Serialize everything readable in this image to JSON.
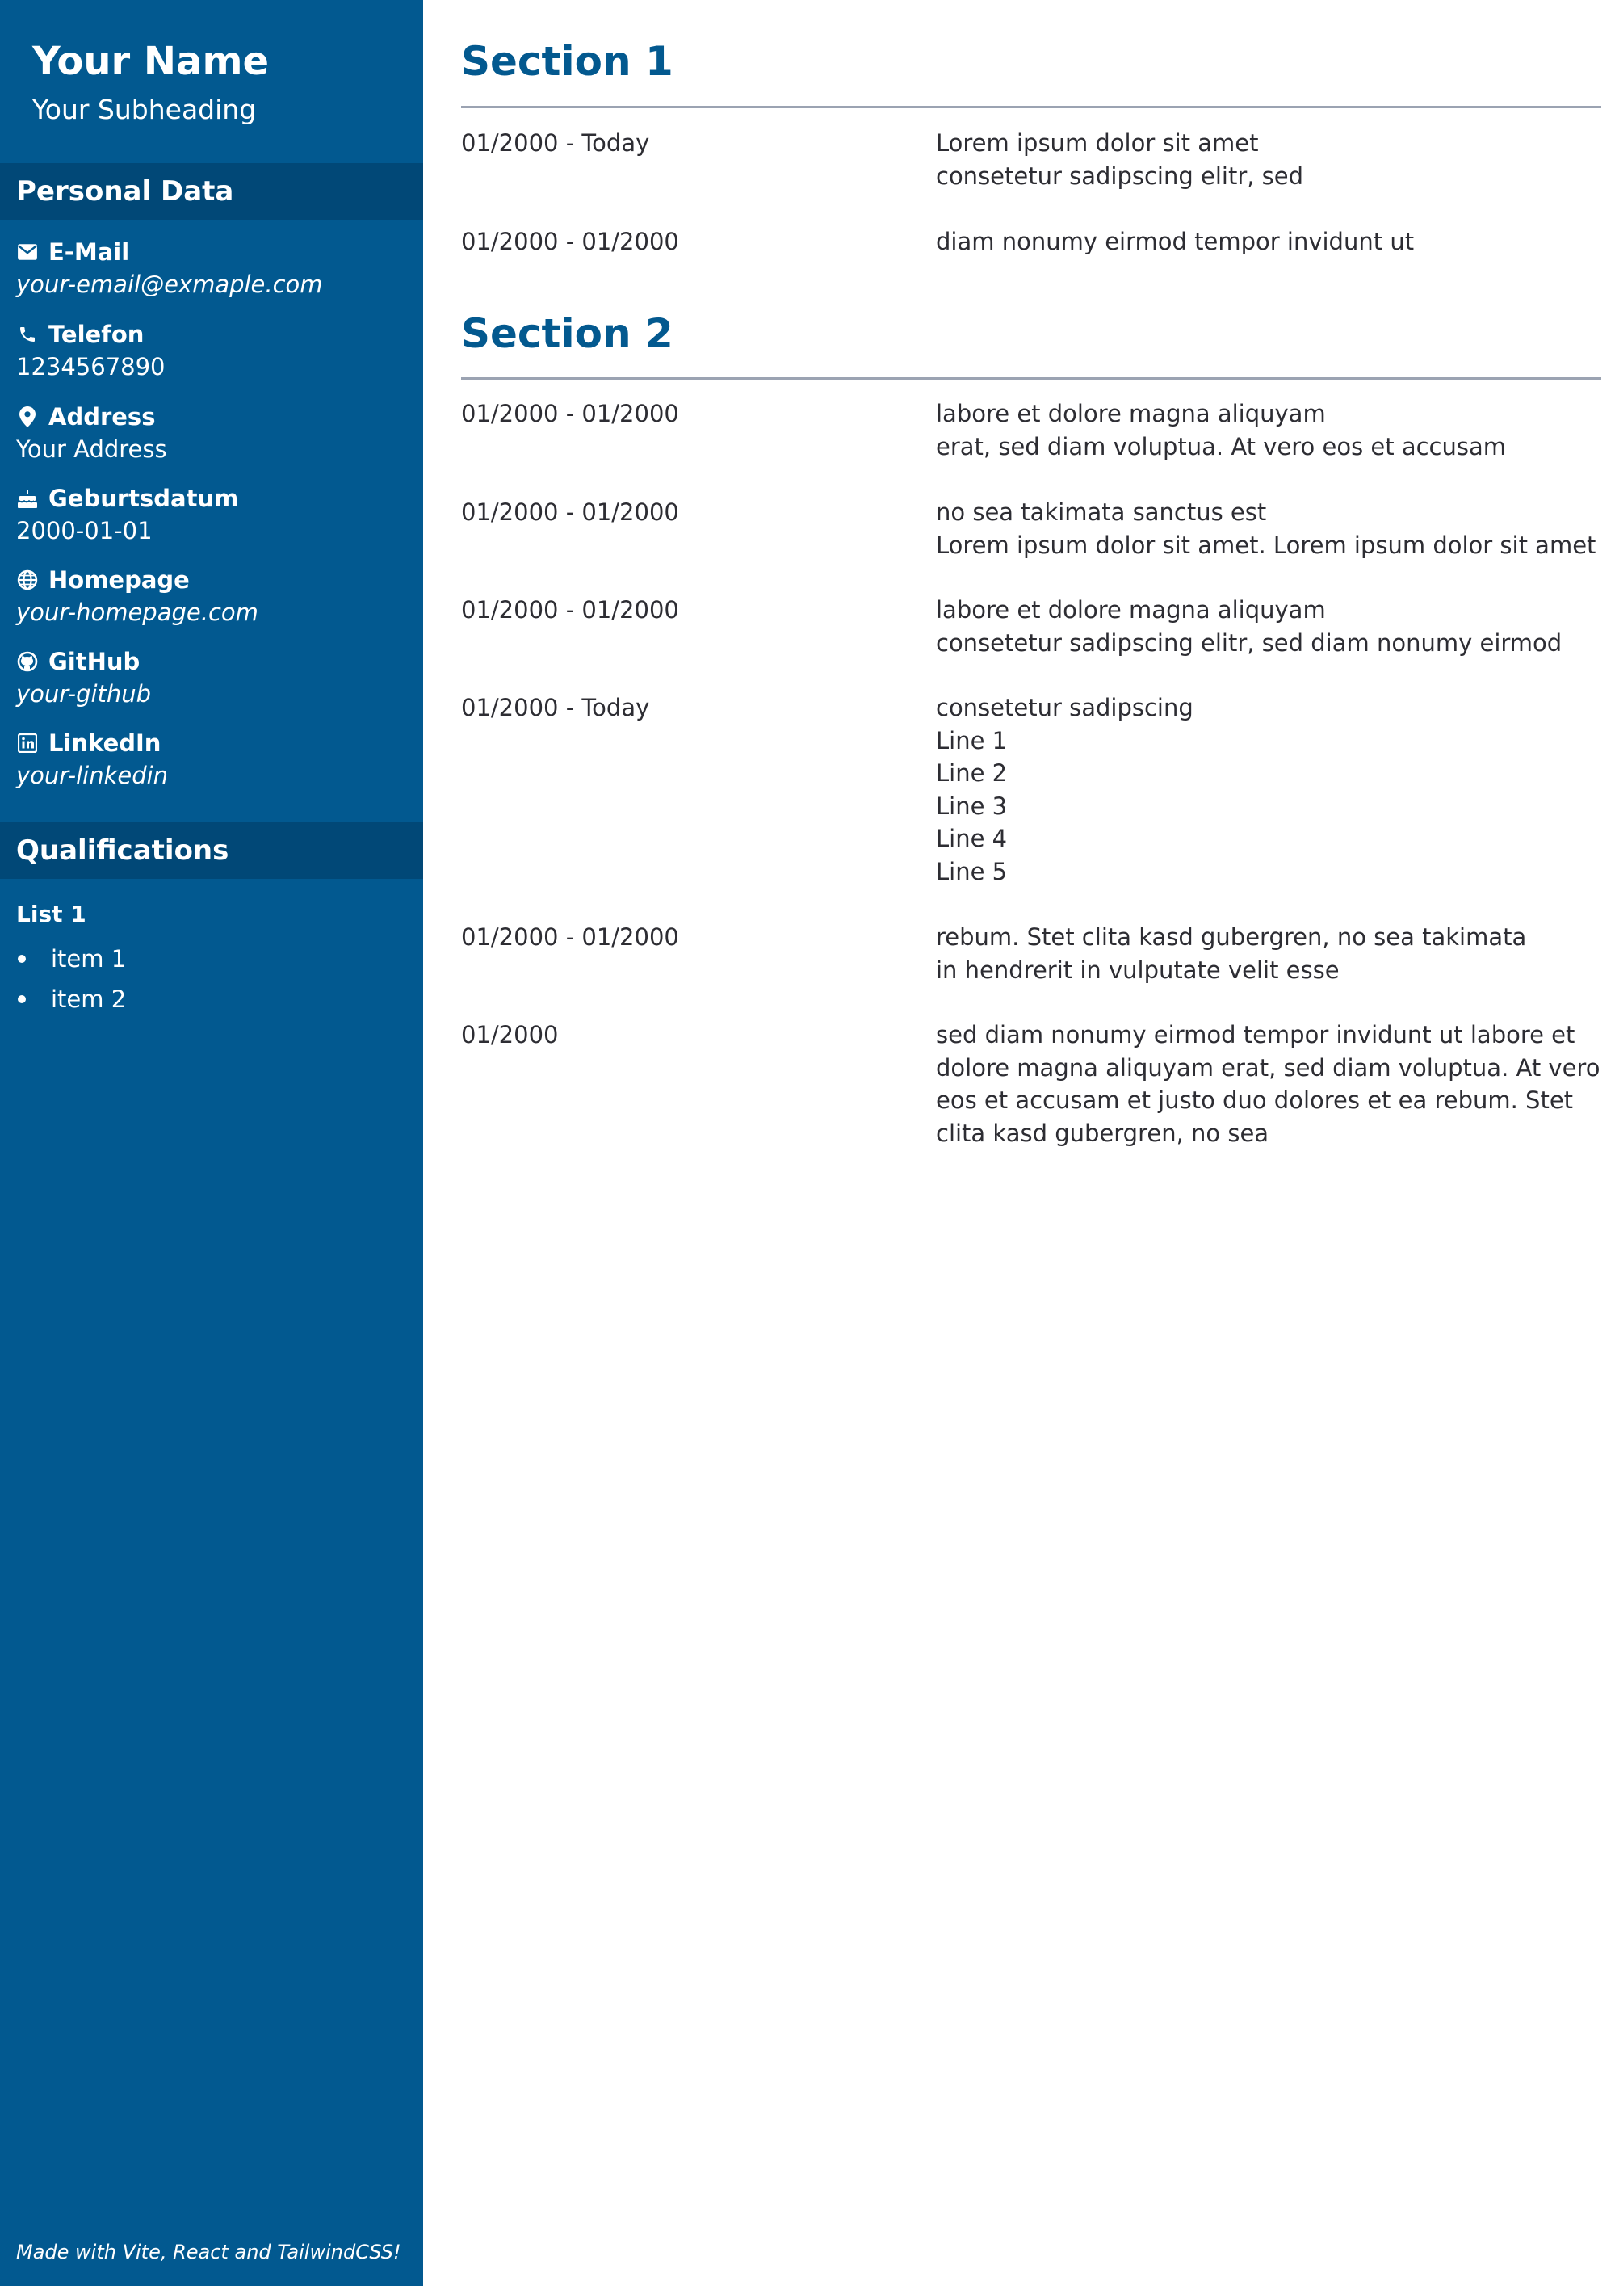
{
  "sidebar": {
    "name": "Your Name",
    "subheading": "Your Subheading",
    "personal_data_title": "Personal Data",
    "contacts": [
      {
        "icon": "mail-icon",
        "label": "E-Mail",
        "value": "your-email@exmaple.com",
        "italic": true
      },
      {
        "icon": "phone-icon",
        "label": "Telefon",
        "value": "1234567890",
        "italic": false
      },
      {
        "icon": "map-pin-icon",
        "label": "Address",
        "value": "Your Address",
        "italic": false
      },
      {
        "icon": "cake-icon",
        "label": "Geburtsdatum",
        "value": "2000-01-01",
        "italic": false
      },
      {
        "icon": "globe-icon",
        "label": "Homepage",
        "value": "your-homepage.com",
        "italic": true
      },
      {
        "icon": "github-icon",
        "label": "GitHub",
        "value": "your-github",
        "italic": true
      },
      {
        "icon": "linkedin-icon",
        "label": "LinkedIn",
        "value": "your-linkedin",
        "italic": true
      }
    ],
    "qualifications_title": "Qualifications",
    "list_title": "List 1",
    "list_items": [
      "item 1",
      "item 2"
    ],
    "footer_note": "Made with Vite, React and TailwindCSS!"
  },
  "main": {
    "sections": [
      {
        "title": "Section 1",
        "entries": [
          {
            "date": "01/2000 - Today",
            "lines": [
              "Lorem ipsum dolor sit amet",
              "consetetur sadipscing elitr, sed"
            ]
          },
          {
            "date": "01/2000 - 01/2000",
            "lines": [
              "diam nonumy eirmod tempor invidunt ut"
            ]
          }
        ]
      },
      {
        "title": "Section 2",
        "entries": [
          {
            "date": "01/2000 - 01/2000",
            "lines": [
              "labore et dolore magna aliquyam",
              "erat, sed diam voluptua. At vero eos et accusam"
            ]
          },
          {
            "date": "01/2000 - 01/2000",
            "lines": [
              "no sea takimata sanctus est",
              "Lorem ipsum dolor sit amet. Lorem ipsum dolor sit amet"
            ]
          },
          {
            "date": "01/2000 - 01/2000",
            "lines": [
              "labore et dolore magna aliquyam",
              "consetetur sadipscing elitr, sed diam nonumy eirmod"
            ]
          },
          {
            "date": "01/2000 - Today",
            "lines": [
              "consetetur sadipscing",
              "Line 1",
              "Line 2",
              "Line 3",
              "Line 4",
              "Line 5"
            ]
          },
          {
            "date": "01/2000 - 01/2000",
            "lines": [
              "rebum. Stet clita kasd gubergren, no sea takimata",
              "in hendrerit in vulputate velit esse"
            ]
          },
          {
            "date": "01/2000",
            "paragraph": "sed diam nonumy eirmod tempor invidunt ut labore et dolore magna aliquyam erat, sed diam voluptua. At vero eos et accusam et justo duo dolores et ea rebum. Stet clita kasd gubergren, no sea"
          }
        ]
      }
    ]
  },
  "colors": {
    "sidebar_bg": "#025990",
    "sidebar_header_bg": "#014877",
    "section_title": "#03598f",
    "rule": "#9ba3b2",
    "text": "#2d2d33"
  }
}
